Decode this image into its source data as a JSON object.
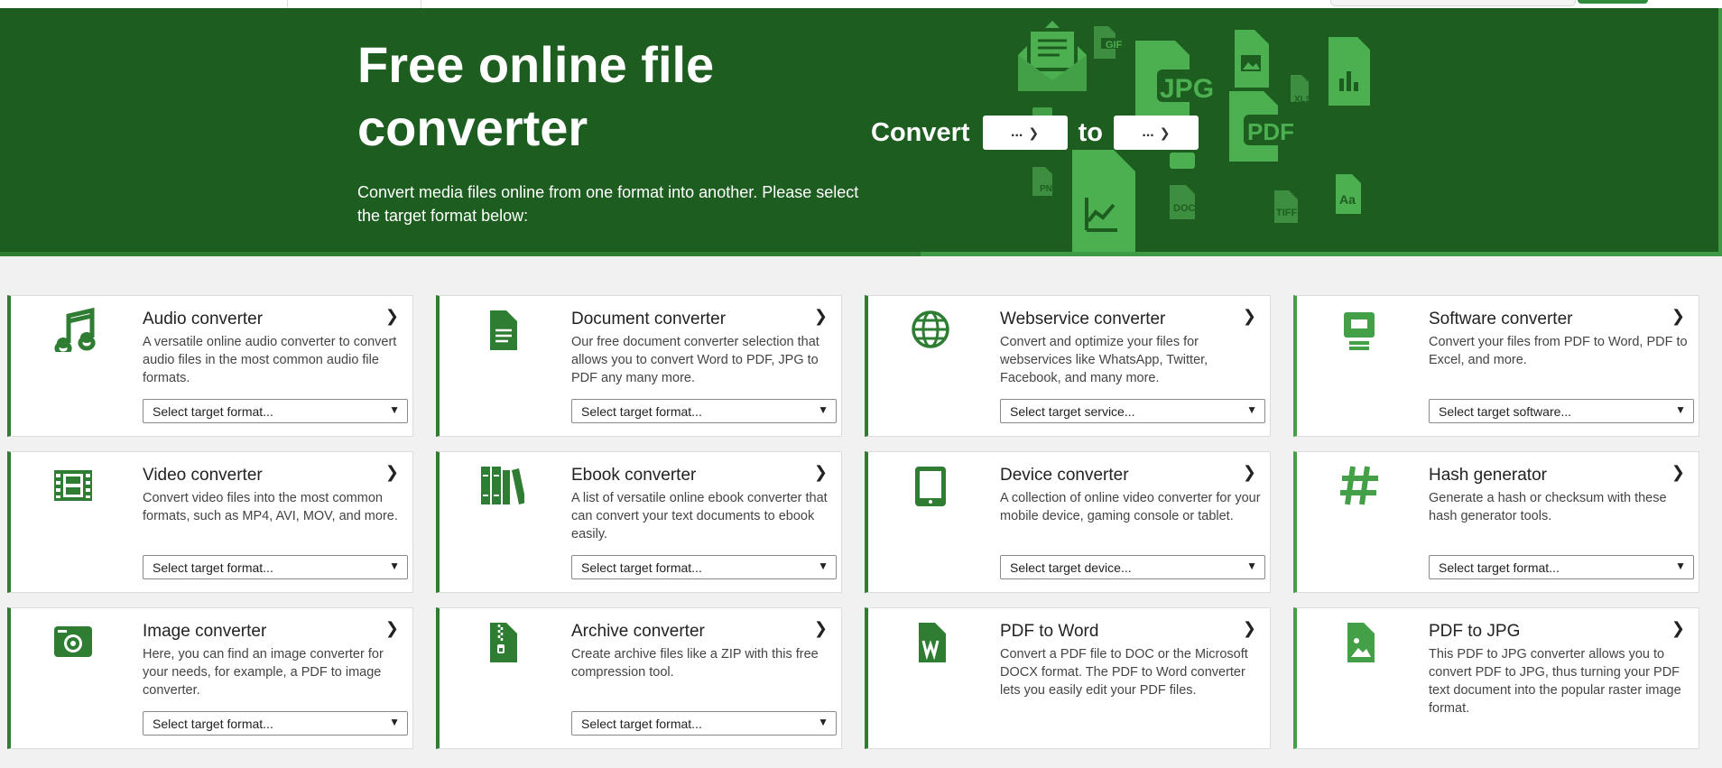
{
  "hero": {
    "title": "Free online file converter",
    "description": "Convert media files online from one format into another. Please select the target format below:",
    "convert_label": "Convert",
    "to_label": "to",
    "from_value": "...",
    "to_value": "...",
    "deco_labels": {
      "gif": "GIF",
      "jpg": "JPG",
      "xls": "XLS",
      "pdf": "PDF",
      "png": "PNG",
      "docx": "DOCX",
      "tiff": "TIFF",
      "font": "Aa"
    }
  },
  "colors": {
    "hero_bg": "#1d5e20",
    "accent_dark": "#2e7d32",
    "accent_light": "#43a047",
    "deco": "#4caf50"
  },
  "cards": [
    {
      "title": "Audio converter",
      "desc": "A versatile online audio converter to convert audio files in the most common audio file formats.",
      "select": "Select target format...",
      "icon": "music-note-icon"
    },
    {
      "title": "Document converter",
      "desc": "Our free document converter selection that allows you to convert Word to PDF, JPG to PDF any many more.",
      "select": "Select target format...",
      "icon": "document-icon"
    },
    {
      "title": "Webservice converter",
      "desc": "Convert and optimize your files for webservices like WhatsApp, Twitter, Facebook, and many more.",
      "select": "Select target service...",
      "icon": "globe-icon"
    },
    {
      "title": "Software converter",
      "desc": "Convert your files from PDF to Word, PDF to Excel, and more.",
      "select": "Select target software...",
      "icon": "monitor-icon"
    },
    {
      "title": "Video converter",
      "desc": "Convert video files into the most common formats, such as MP4, AVI, MOV, and more.",
      "select": "Select target format...",
      "icon": "film-icon"
    },
    {
      "title": "Ebook converter",
      "desc": "A list of versatile online ebook converter that can convert your text documents to ebook easily.",
      "select": "Select target format...",
      "icon": "books-icon"
    },
    {
      "title": "Device converter",
      "desc": "A collection of online video converter for your mobile device, gaming console or tablet.",
      "select": "Select target device...",
      "icon": "tablet-icon"
    },
    {
      "title": "Hash generator",
      "desc": "Generate a hash or checksum with these hash generator tools.",
      "select": "Select target format...",
      "icon": "hash-icon"
    },
    {
      "title": "Image converter",
      "desc": "Here, you can find an image converter for your needs, for example, a PDF to image converter.",
      "select": "Select target format...",
      "icon": "camera-icon"
    },
    {
      "title": "Archive converter",
      "desc": "Create archive files like a ZIP with this free compression tool.",
      "select": "Select target format...",
      "icon": "zip-file-icon"
    },
    {
      "title": "PDF to Word",
      "desc": "Convert a PDF file to DOC or the Microsoft DOCX format. The PDF to Word converter lets you easily edit your PDF files.",
      "icon": "word-file-icon"
    },
    {
      "title": "PDF to JPG",
      "desc": "This PDF to JPG converter allows you to convert PDF to JPG, thus turning your PDF text document into the popular raster image format.",
      "icon": "image-file-icon"
    }
  ]
}
